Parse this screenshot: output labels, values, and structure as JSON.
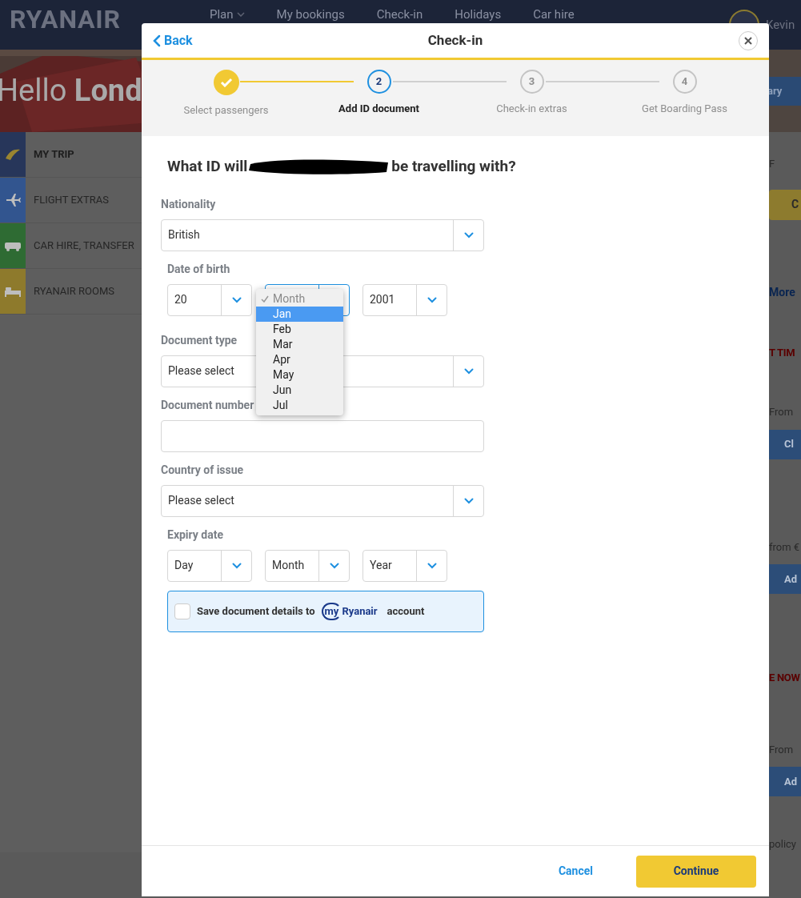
{
  "header": {
    "logo": "RYANAIR",
    "nav": [
      {
        "label": "Plan",
        "dropdown": true
      },
      {
        "label": "My bookings",
        "dropdown": false
      },
      {
        "label": "Check-in",
        "dropdown": false
      },
      {
        "label": "Holidays",
        "dropdown": false
      },
      {
        "label": "Car hire",
        "dropdown": false
      }
    ],
    "user": "Kevin"
  },
  "hero": {
    "greeting": "Hello",
    "name": "Lond",
    "button": "ary"
  },
  "sidebar": {
    "items": [
      {
        "label": "MY TRIP",
        "selected": true,
        "color": "#27365a",
        "kind": "logo"
      },
      {
        "label": "FLIGHT EXTRAS",
        "selected": false,
        "color": "#32558f",
        "kind": "plane"
      },
      {
        "label": "CAR HIRE, TRANSFER",
        "selected": false,
        "color": "#2e6b33",
        "kind": "car"
      },
      {
        "label": "RYANAIR ROOMS",
        "selected": false,
        "color": "#8e7a2c",
        "kind": "bed"
      }
    ]
  },
  "right_strip": [
    {
      "kind": "text",
      "text": "F"
    },
    {
      "kind": "pill",
      "text": "C"
    },
    {
      "kind": "link",
      "text": "More"
    },
    {
      "kind": "alert",
      "text": "T TIM"
    },
    {
      "kind": "text",
      "text": "From"
    },
    {
      "kind": "button",
      "text": "Cl"
    },
    {
      "kind": "text",
      "text": "from €"
    },
    {
      "kind": "button",
      "text": "Ad"
    },
    {
      "kind": "alert",
      "text": "E NOW"
    },
    {
      "kind": "text",
      "text": "From"
    },
    {
      "kind": "button",
      "text": "Ad"
    },
    {
      "kind": "text",
      "text": "policy"
    }
  ],
  "modal": {
    "back": "Back",
    "title": "Check-in",
    "steps": [
      {
        "label": "Select passengers",
        "completed": true,
        "selected": false
      },
      {
        "number": "2",
        "label": "Add ID document",
        "completed": false,
        "selected": true
      },
      {
        "number": "3",
        "label": "Check-in extras",
        "completed": false,
        "selected": false
      },
      {
        "number": "4",
        "label": "Get Boarding Pass",
        "completed": false,
        "selected": false
      }
    ],
    "question_start": "What ID will",
    "question_end": "be travelling with?",
    "nationality": {
      "label": "Nationality",
      "value": "British"
    },
    "date_of_birth": {
      "label": "Date of birth",
      "fields": [
        {
          "value": "20",
          "focused": false
        },
        {
          "focused": true
        },
        {
          "value": "2001",
          "focused": false
        }
      ],
      "dropdown": [
        {
          "label": "Month",
          "checked": true,
          "selected": false,
          "disabled": true
        },
        {
          "label": "Jan",
          "checked": false,
          "selected": true,
          "disabled": false
        },
        {
          "label": "Feb",
          "checked": false,
          "selected": false,
          "disabled": false
        },
        {
          "label": "Mar",
          "checked": false,
          "selected": false,
          "disabled": false
        },
        {
          "label": "Apr",
          "checked": false,
          "selected": false,
          "disabled": false
        },
        {
          "label": "May",
          "checked": false,
          "selected": false,
          "disabled": false
        },
        {
          "label": "Jun",
          "checked": false,
          "selected": false,
          "disabled": false
        },
        {
          "label": "Jul",
          "checked": false,
          "selected": false,
          "disabled": false
        }
      ]
    },
    "document_type": {
      "label": "Document type",
      "value": "Please select"
    },
    "document_number": {
      "label": "Document number"
    },
    "country_of_issue": {
      "label": "Country of issue",
      "value": "Please select"
    },
    "expiry_date": {
      "label": "Expiry date",
      "fields": [
        {
          "value": "Day",
          "focused": false
        },
        {
          "value": "Month",
          "focused": false
        },
        {
          "value": "Year",
          "focused": false
        }
      ]
    },
    "save": {
      "checked": false,
      "text": "Save document details to",
      "brand_my": "my",
      "brand_name": "Ryanair",
      "suffix": "account"
    },
    "cancel": "Cancel",
    "continue": "Continue"
  }
}
